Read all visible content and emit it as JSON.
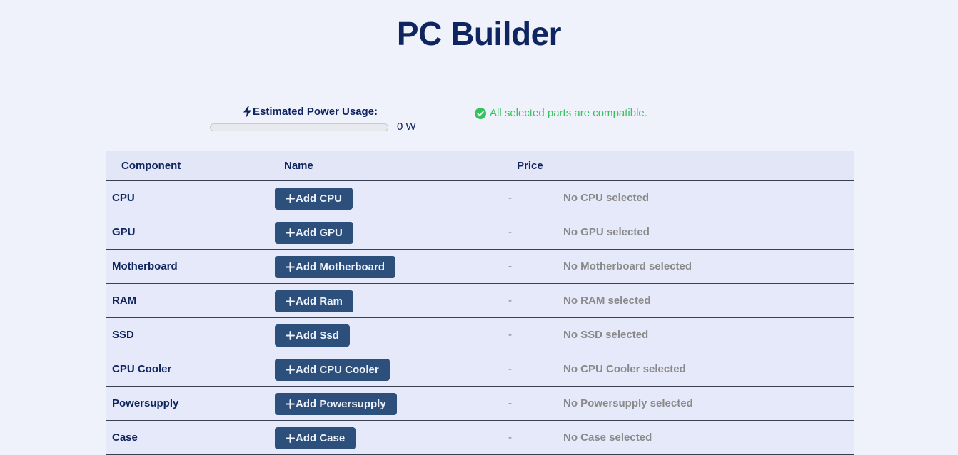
{
  "page": {
    "title": "PC Builder"
  },
  "power": {
    "label": "Estimated Power Usage:",
    "value": "0 W",
    "fill_fraction": 0,
    "icon": "bolt-icon"
  },
  "compatibility": {
    "message": "All selected parts are compatible.",
    "icon": "check-circle-icon",
    "color": "#32c35c"
  },
  "table": {
    "headers": {
      "component": "Component",
      "name": "Name",
      "price": "Price"
    },
    "rows": [
      {
        "component": "CPU",
        "button": "Add CPU",
        "price": "-",
        "status": "No CPU selected"
      },
      {
        "component": "GPU",
        "button": "Add GPU",
        "price": "-",
        "status": "No GPU selected"
      },
      {
        "component": "Motherboard",
        "button": "Add Motherboard",
        "price": "-",
        "status": "No Motherboard selected"
      },
      {
        "component": "RAM",
        "button": "Add Ram",
        "price": "-",
        "status": "No RAM selected"
      },
      {
        "component": "SSD",
        "button": "Add Ssd",
        "price": "-",
        "status": "No SSD selected"
      },
      {
        "component": "CPU Cooler",
        "button": "Add CPU Cooler",
        "price": "-",
        "status": "No CPU Cooler selected"
      },
      {
        "component": "Powersupply",
        "button": "Add Powersupply",
        "price": "-",
        "status": "No Powersupply selected"
      },
      {
        "component": "Case",
        "button": "Add Case",
        "price": "-",
        "status": "No Case selected"
      }
    ]
  },
  "colors": {
    "background": "#f0f2fb",
    "primary_text": "#0f2560",
    "button": "#2c4f7c",
    "muted_text": "#8a8a8a",
    "success": "#32c35c"
  }
}
